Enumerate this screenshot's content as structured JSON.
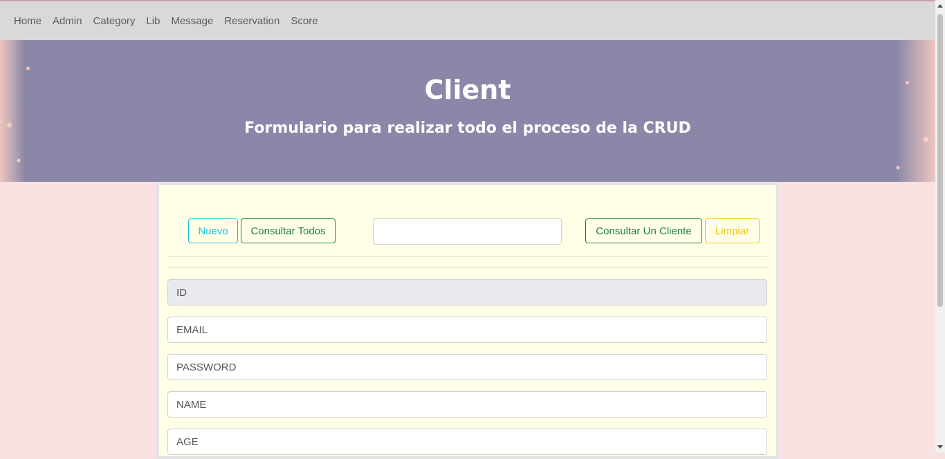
{
  "nav": {
    "items": [
      {
        "label": "Home"
      },
      {
        "label": "Admin"
      },
      {
        "label": "Category"
      },
      {
        "label": "Lib"
      },
      {
        "label": "Message"
      },
      {
        "label": "Reservation"
      },
      {
        "label": "Score"
      }
    ]
  },
  "hero": {
    "title": "Client",
    "subtitle": "Formulario para realizar todo el proceso de la CRUD"
  },
  "toolbar": {
    "nuevo_label": "Nuevo",
    "consultar_todos_label": "Consultar Todos",
    "search_value": "",
    "consultar_uno_label": "Consultar Un Cliente",
    "limpiar_label": "Limpiar"
  },
  "form": {
    "id_placeholder": "ID",
    "email_placeholder": "EMAIL",
    "password_placeholder": "PASSWORD",
    "name_placeholder": "NAME",
    "age_placeholder": "AGE"
  },
  "colors": {
    "page_bg": "#f9e1e1",
    "navbar_bg": "#d9d9d9",
    "hero_bg": "#8a87a8",
    "panel_bg": "#ffffe8",
    "info": "#1ebfd6",
    "success": "#1f7d43",
    "warning": "#f0c419"
  }
}
